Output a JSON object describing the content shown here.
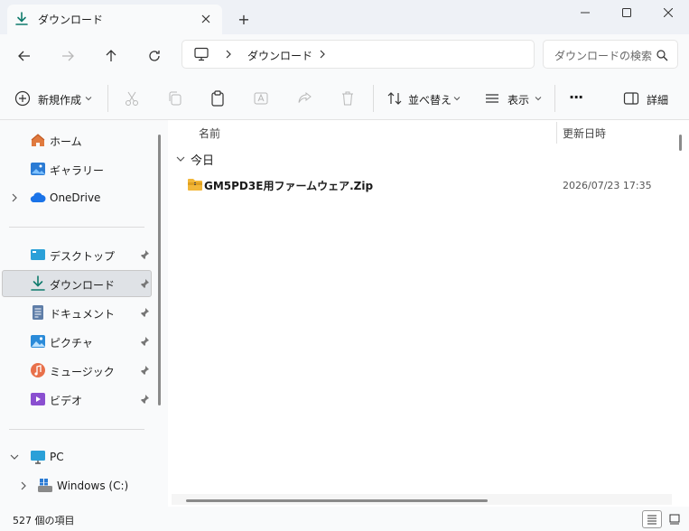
{
  "window": {
    "tab_label": "ダウンロード",
    "new_tab": "+"
  },
  "address": {
    "crumb": "ダウンロード",
    "search_placeholder": "ダウンロードの検索"
  },
  "toolbar": {
    "new_label": "新規作成",
    "sort_label": "並べ替え",
    "view_label": "表示",
    "more_label": "···",
    "details_label": "詳細"
  },
  "sidebar": {
    "home": "ホーム",
    "gallery": "ギャラリー",
    "onedrive": "OneDrive",
    "desktop": "デスクトップ",
    "downloads": "ダウンロード",
    "documents": "ドキュメント",
    "pictures": "ピクチャ",
    "music": "ミュージック",
    "videos": "ビデオ",
    "pc": "PC",
    "drive_c": "Windows (C:)"
  },
  "content": {
    "col_name": "名前",
    "col_date": "更新日時",
    "group_label": "今日",
    "files": [
      {
        "name": "GM5PD3E用ファームウェア.Zip",
        "modified": "2026/07/23 17:35"
      }
    ]
  },
  "status": {
    "item_count": "527 個の項目"
  },
  "colors": {
    "accent": "#0f7b6c",
    "selection": "#dfe2e6"
  }
}
